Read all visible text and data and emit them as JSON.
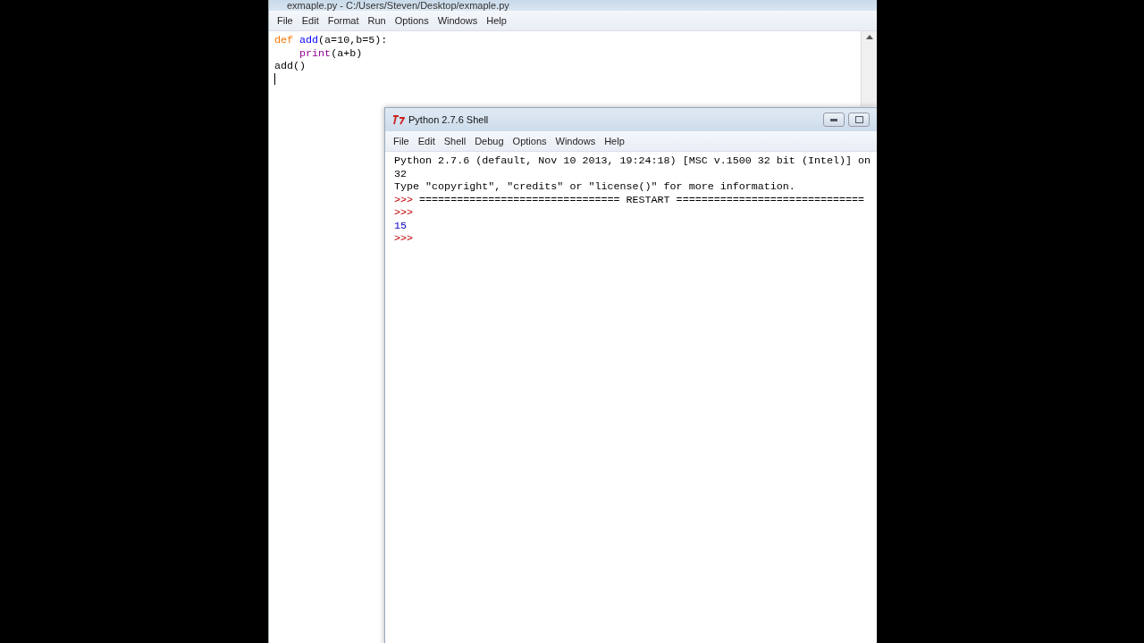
{
  "editor": {
    "title": "exmaple.py - C:/Users/Steven/Desktop/exmaple.py",
    "menu": [
      "File",
      "Edit",
      "Format",
      "Run",
      "Options",
      "Windows",
      "Help"
    ],
    "lines": [
      {
        "segments": [
          {
            "kind": "keyword",
            "text": "def"
          },
          {
            "kind": "defname",
            "text": "add"
          },
          {
            "kind": "plain",
            "text": "(a=10,b=5):"
          }
        ],
        "children": [
          {
            "segments": [
              {
                "kind": "builtin",
                "text": "print"
              },
              {
                "kind": "plain",
                "text": "(a+b)"
              }
            ]
          }
        ]
      },
      {
        "segments": [
          {
            "kind": "plain",
            "text": "add()"
          }
        ]
      }
    ]
  },
  "shell": {
    "title": "Python 2.7.6 Shell",
    "menu": [
      "File",
      "Edit",
      "Shell",
      "Debug",
      "Options",
      "Windows",
      "Help"
    ],
    "lines": [
      {
        "kind": "output",
        "text": "Python 2.7.6 (default, Nov 10 2013, 19:24:18) [MSC v.1500 32 bit (Intel)] on"
      },
      {
        "kind": "output",
        "text": "32"
      },
      {
        "kind": "output",
        "text": "Type \"copyright\", \"credits\" or \"license()\" for more information."
      },
      {
        "kind": "prompt",
        "prompt": ">>>",
        "text": "================================ RESTART =============================="
      },
      {
        "kind": "prompt",
        "prompt": ">>>"
      },
      {
        "kind": "result",
        "text": "15"
      },
      {
        "kind": "prompt",
        "prompt": ">>>"
      }
    ]
  }
}
